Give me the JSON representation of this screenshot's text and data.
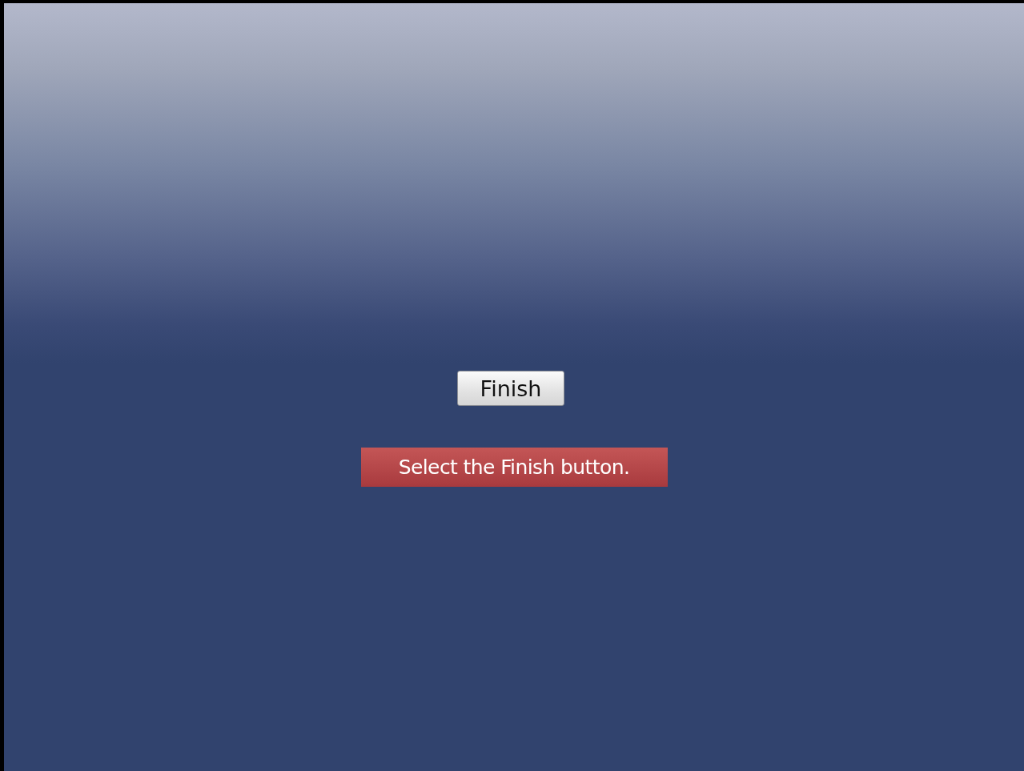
{
  "button": {
    "label": "Finish"
  },
  "instruction": {
    "text": "Select the Finish button."
  }
}
